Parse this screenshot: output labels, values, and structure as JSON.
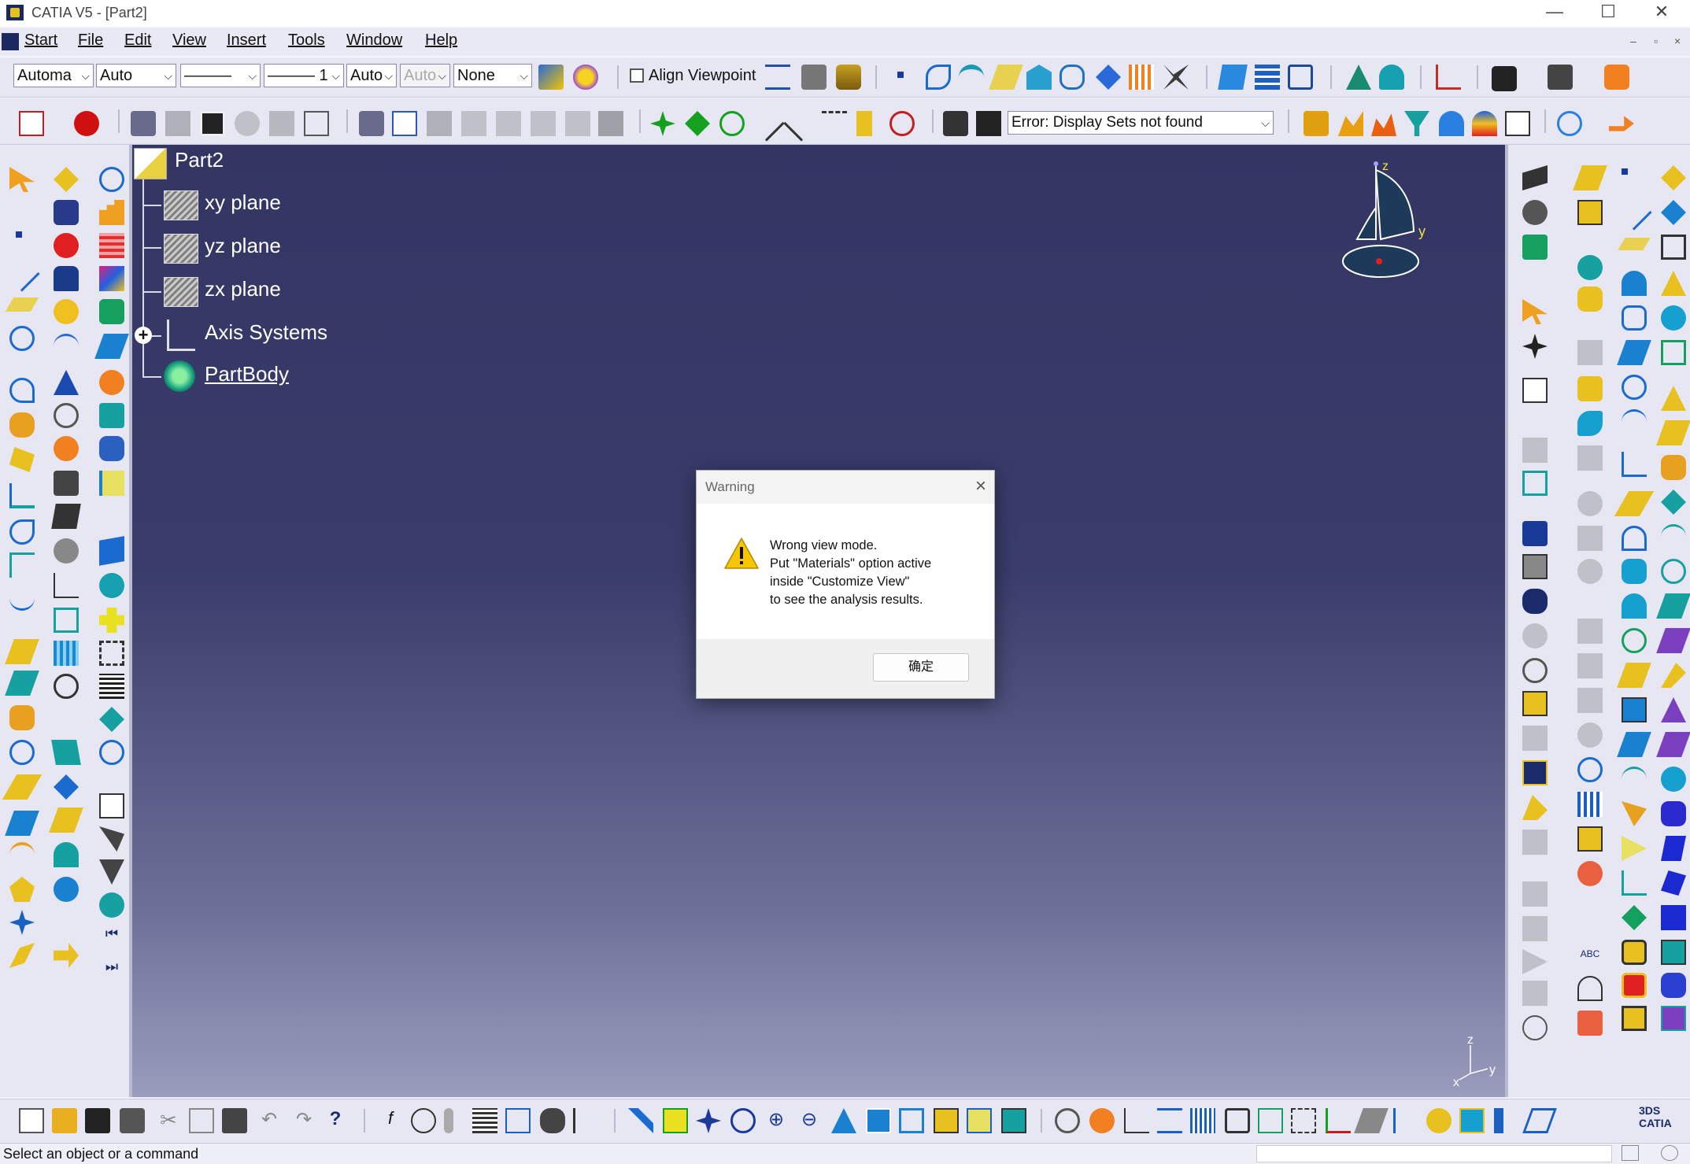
{
  "window": {
    "title": "CATIA V5 - [Part2]",
    "controls": {
      "minimize": "—",
      "maximize": "☐",
      "close": "✕"
    }
  },
  "menu": {
    "items": [
      {
        "label": "Start"
      },
      {
        "label": "File"
      },
      {
        "label": "Edit"
      },
      {
        "label": "View"
      },
      {
        "label": "Insert"
      },
      {
        "label": "Tools"
      },
      {
        "label": "Window"
      },
      {
        "label": "Help"
      }
    ],
    "mdi_controls": {
      "minimize": "–",
      "restore": "▫",
      "close": "×"
    }
  },
  "graphic_properties": {
    "color": "Automa",
    "transparency": "Auto",
    "linetype": "———",
    "thickness": "——— 1",
    "point": "Auto",
    "layer_disabled": "Auto",
    "rendering": "None",
    "align_viewpoint_label": "Align Viewpoint",
    "align_viewpoint_checked": false
  },
  "sets_combo": {
    "value": "Error: Display Sets not found"
  },
  "tree": {
    "root": "Part2",
    "nodes": [
      {
        "label": "xy plane",
        "icon": "plane-icon"
      },
      {
        "label": "yz plane",
        "icon": "plane-icon"
      },
      {
        "label": "zx plane",
        "icon": "plane-icon"
      },
      {
        "label": "Axis Systems",
        "icon": "axis-system-icon",
        "expandable": true
      },
      {
        "label": "PartBody",
        "icon": "gear-body-icon"
      }
    ]
  },
  "compass": {
    "z": "z",
    "y": "y"
  },
  "axis_indicator": {
    "z": "z",
    "y": "y",
    "x": "x"
  },
  "dialog": {
    "title": "Warning",
    "icon": "warning-icon",
    "lines": [
      "Wrong view mode.",
      "Put \"Materials\" option active",
      "inside \"Customize View\"",
      "to see the analysis results."
    ],
    "ok_label": "确定"
  },
  "status": {
    "text": "Select an object or a command"
  },
  "colors": {
    "viewport_top": "#333563",
    "viewport_bottom": "#9a9cbd",
    "panel": "#e6e7f3",
    "warning_yellow": "#f7c600"
  }
}
